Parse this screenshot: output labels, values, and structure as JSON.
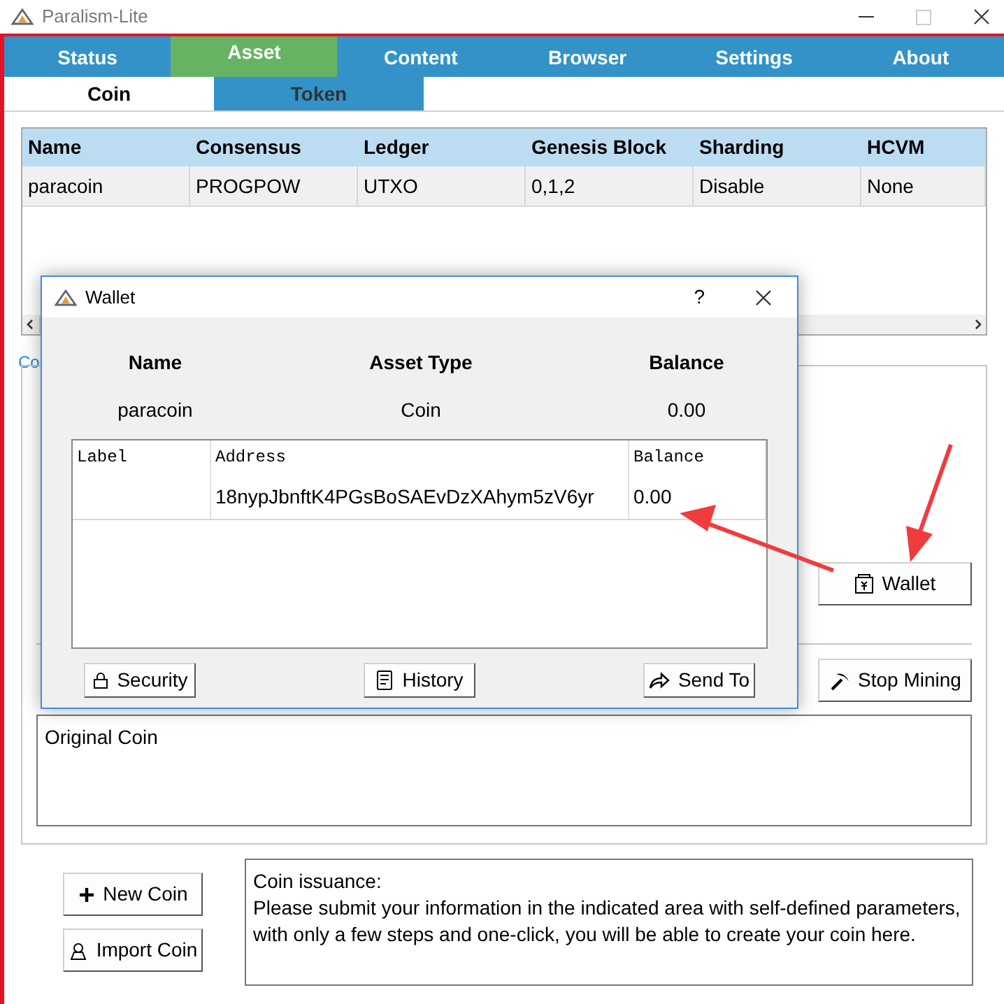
{
  "window": {
    "title": "Paralism-Lite"
  },
  "tabs": [
    {
      "label": "Status",
      "selected": false
    },
    {
      "label": "Asset",
      "selected": true
    },
    {
      "label": "Content",
      "selected": false
    },
    {
      "label": "Browser",
      "selected": false
    },
    {
      "label": "Settings",
      "selected": false
    },
    {
      "label": "About",
      "selected": false
    }
  ],
  "subtabs": [
    {
      "label": "Coin",
      "selected": true
    },
    {
      "label": "Token",
      "selected": false
    }
  ],
  "table": {
    "columns": [
      "Name",
      "Consensus",
      "Ledger",
      "Genesis Block",
      "Sharding",
      "HCVM"
    ],
    "rows": [
      [
        "paracoin",
        "PROGPOW",
        "UTXO",
        "0,1,2",
        "Disable",
        "None"
      ]
    ]
  },
  "coin_group": {
    "title": "Co",
    "wallet_button": "Wallet",
    "stop_button": "Stop Mining",
    "description": "Original Coin"
  },
  "actions": [
    {
      "label": "New Coin",
      "kind": "plus"
    },
    {
      "label": "Import Coin",
      "kind": "import"
    }
  ],
  "info": {
    "title": "Coin issuance:",
    "text": "Please submit your information in the indicated area with self-defined parameters, with only a few steps and one-click, you will be able to create your coin here."
  },
  "dialog": {
    "title": "Wallet",
    "help": "?",
    "summary": {
      "columns": [
        "Name",
        "Asset Type",
        "Balance"
      ],
      "values": [
        "paracoin",
        "Coin",
        "0.00"
      ]
    },
    "addresses": {
      "columns": [
        "Label",
        "Address",
        "Balance"
      ],
      "rows": [
        [
          "",
          "18nypJbnftK4PGsBoSAEvDzXAhym5zV6yr",
          "0.00"
        ]
      ]
    },
    "buttons": [
      {
        "label": "Security",
        "kind": "lock"
      },
      {
        "label": "History",
        "kind": "history"
      },
      {
        "label": "Send To",
        "kind": "send"
      }
    ]
  }
}
